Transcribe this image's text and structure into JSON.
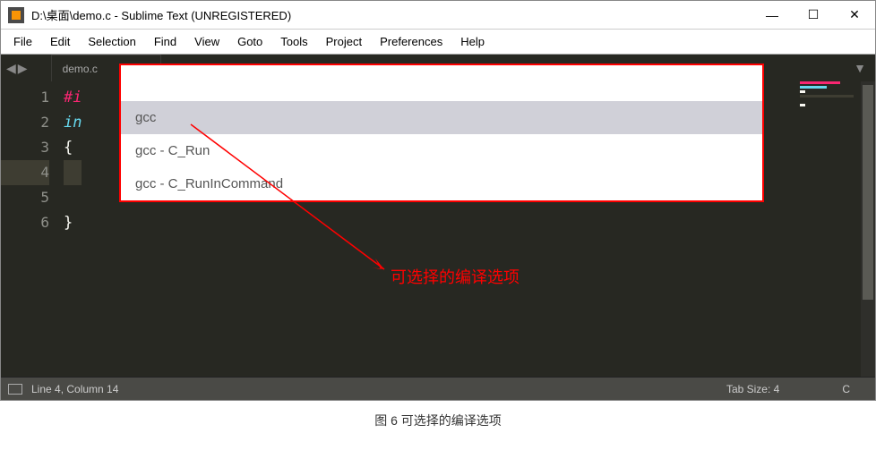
{
  "titlebar": {
    "title": "D:\\桌面\\demo.c - Sublime Text (UNREGISTERED)",
    "minimize": "—",
    "maximize": "☐",
    "close": "✕"
  },
  "menubar": [
    "File",
    "Edit",
    "Selection",
    "Find",
    "View",
    "Goto",
    "Tools",
    "Project",
    "Preferences",
    "Help"
  ],
  "nav": {
    "back": "◀",
    "forward": "▶"
  },
  "tab": {
    "name": "demo.c",
    "close": "×"
  },
  "tabbar_dropdown": "▼",
  "code": {
    "lines": [
      "1",
      "2",
      "3",
      "4",
      "5",
      "6"
    ],
    "text1": "#i",
    "text2": "in",
    "brace_open": "{",
    "brace_close": "}"
  },
  "popup": {
    "items": [
      {
        "label": "gcc",
        "highlighted": true
      },
      {
        "label": "gcc - C_Run",
        "highlighted": false
      },
      {
        "label": "gcc - C_RunInCommand",
        "highlighted": false
      }
    ]
  },
  "annotation": "可选择的编译选项",
  "statusbar": {
    "position": "Line 4, Column 14",
    "tabsize": "Tab Size: 4",
    "syntax": "C"
  },
  "caption": "图 6 可选择的编译选项"
}
